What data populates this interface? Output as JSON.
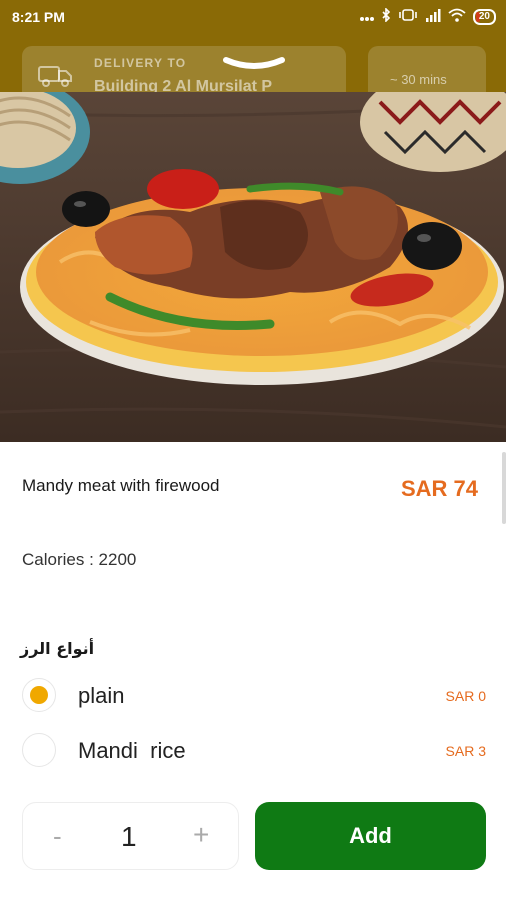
{
  "status_bar": {
    "time": "8:21 PM",
    "icons": [
      "dots-icon",
      "bluetooth-icon",
      "vibrate-icon",
      "signal-icon",
      "wifi-icon"
    ],
    "battery": "20"
  },
  "header": {
    "delivery_label": "DELIVERY TO",
    "delivery_address": "Building 2 Al Mursilat P",
    "eta": "~ 30 mins",
    "truck_icon": "delivery-truck-icon",
    "handle_icon": "chevron-down-icon"
  },
  "item": {
    "name": "Mandy meat with firewood",
    "price": "SAR 74",
    "calories_label": "Calories : ",
    "calories_value": "2200"
  },
  "options_section": {
    "title": "أنواع الرز",
    "options": [
      {
        "name": "plain",
        "price": "SAR 0",
        "selected": true
      },
      {
        "name": "Mandi  rice",
        "price": "SAR 3",
        "selected": false
      }
    ]
  },
  "cart": {
    "minus": "-",
    "quantity": "1",
    "plus": "+",
    "add_label": "Add"
  },
  "colors": {
    "app_bar": "#8a6a06",
    "price": "#e56b1f",
    "selected_radio": "#f0a800",
    "add_button": "#0f7a14"
  }
}
